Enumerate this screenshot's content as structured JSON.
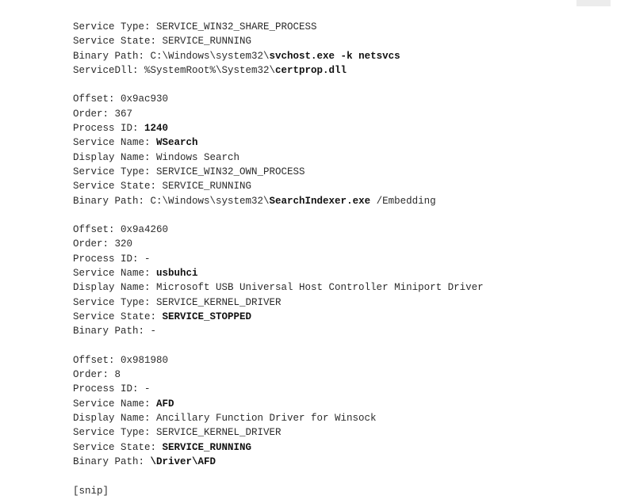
{
  "blocks": [
    {
      "lines": [
        [
          {
            "t": "Service Type: SERVICE_WIN32_SHARE_PROCESS",
            "b": false
          }
        ],
        [
          {
            "t": "Service State: SERVICE_RUNNING",
            "b": false
          }
        ],
        [
          {
            "t": "Binary Path: C:\\Windows\\system32\\",
            "b": false
          },
          {
            "t": "svchost.exe -k netsvcs",
            "b": true
          }
        ],
        [
          {
            "t": "ServiceDll: %SystemRoot%\\System32\\",
            "b": false
          },
          {
            "t": "certprop.dll",
            "b": true
          }
        ]
      ]
    },
    {
      "lines": [
        [
          {
            "t": "Offset: 0x9ac930",
            "b": false
          }
        ],
        [
          {
            "t": "Order: 367",
            "b": false
          }
        ],
        [
          {
            "t": "Process ID: ",
            "b": false
          },
          {
            "t": "1240",
            "b": true
          }
        ],
        [
          {
            "t": "Service Name: ",
            "b": false
          },
          {
            "t": "WSearch",
            "b": true
          }
        ],
        [
          {
            "t": "Display Name: Windows Search",
            "b": false
          }
        ],
        [
          {
            "t": "Service Type: SERVICE_WIN32_OWN_PROCESS",
            "b": false
          }
        ],
        [
          {
            "t": "Service State: SERVICE_RUNNING",
            "b": false
          }
        ],
        [
          {
            "t": "Binary Path: C:\\Windows\\system32\\",
            "b": false
          },
          {
            "t": "SearchIndexer.exe",
            "b": true
          },
          {
            "t": " /Embedding",
            "b": false
          }
        ]
      ]
    },
    {
      "lines": [
        [
          {
            "t": "Offset: 0x9a4260",
            "b": false
          }
        ],
        [
          {
            "t": "Order: 320",
            "b": false
          }
        ],
        [
          {
            "t": "Process ID: -",
            "b": false
          }
        ],
        [
          {
            "t": "Service Name: ",
            "b": false
          },
          {
            "t": "usbuhci",
            "b": true
          }
        ],
        [
          {
            "t": "Display Name: Microsoft USB Universal Host Controller Miniport Driver",
            "b": false
          }
        ],
        [
          {
            "t": "Service Type: SERVICE_KERNEL_DRIVER",
            "b": false
          }
        ],
        [
          {
            "t": "Service State: ",
            "b": false
          },
          {
            "t": "SERVICE_STOPPED",
            "b": true
          }
        ],
        [
          {
            "t": "Binary Path: -",
            "b": false
          }
        ]
      ]
    },
    {
      "lines": [
        [
          {
            "t": "Offset: 0x981980",
            "b": false
          }
        ],
        [
          {
            "t": "Order: 8",
            "b": false
          }
        ],
        [
          {
            "t": "Process ID: -",
            "b": false
          }
        ],
        [
          {
            "t": "Service Name: ",
            "b": false
          },
          {
            "t": "AFD",
            "b": true
          }
        ],
        [
          {
            "t": "Display Name: Ancillary Function Driver for Winsock",
            "b": false
          }
        ],
        [
          {
            "t": "Service Type: SERVICE_KERNEL_DRIVER",
            "b": false
          }
        ],
        [
          {
            "t": "Service State: ",
            "b": false
          },
          {
            "t": "SERVICE_RUNNING",
            "b": true
          }
        ],
        [
          {
            "t": "Binary Path: ",
            "b": false
          },
          {
            "t": "\\Driver\\AFD",
            "b": true
          }
        ]
      ]
    },
    {
      "lines": [
        [
          {
            "t": "[snip]",
            "b": false
          }
        ]
      ]
    }
  ]
}
